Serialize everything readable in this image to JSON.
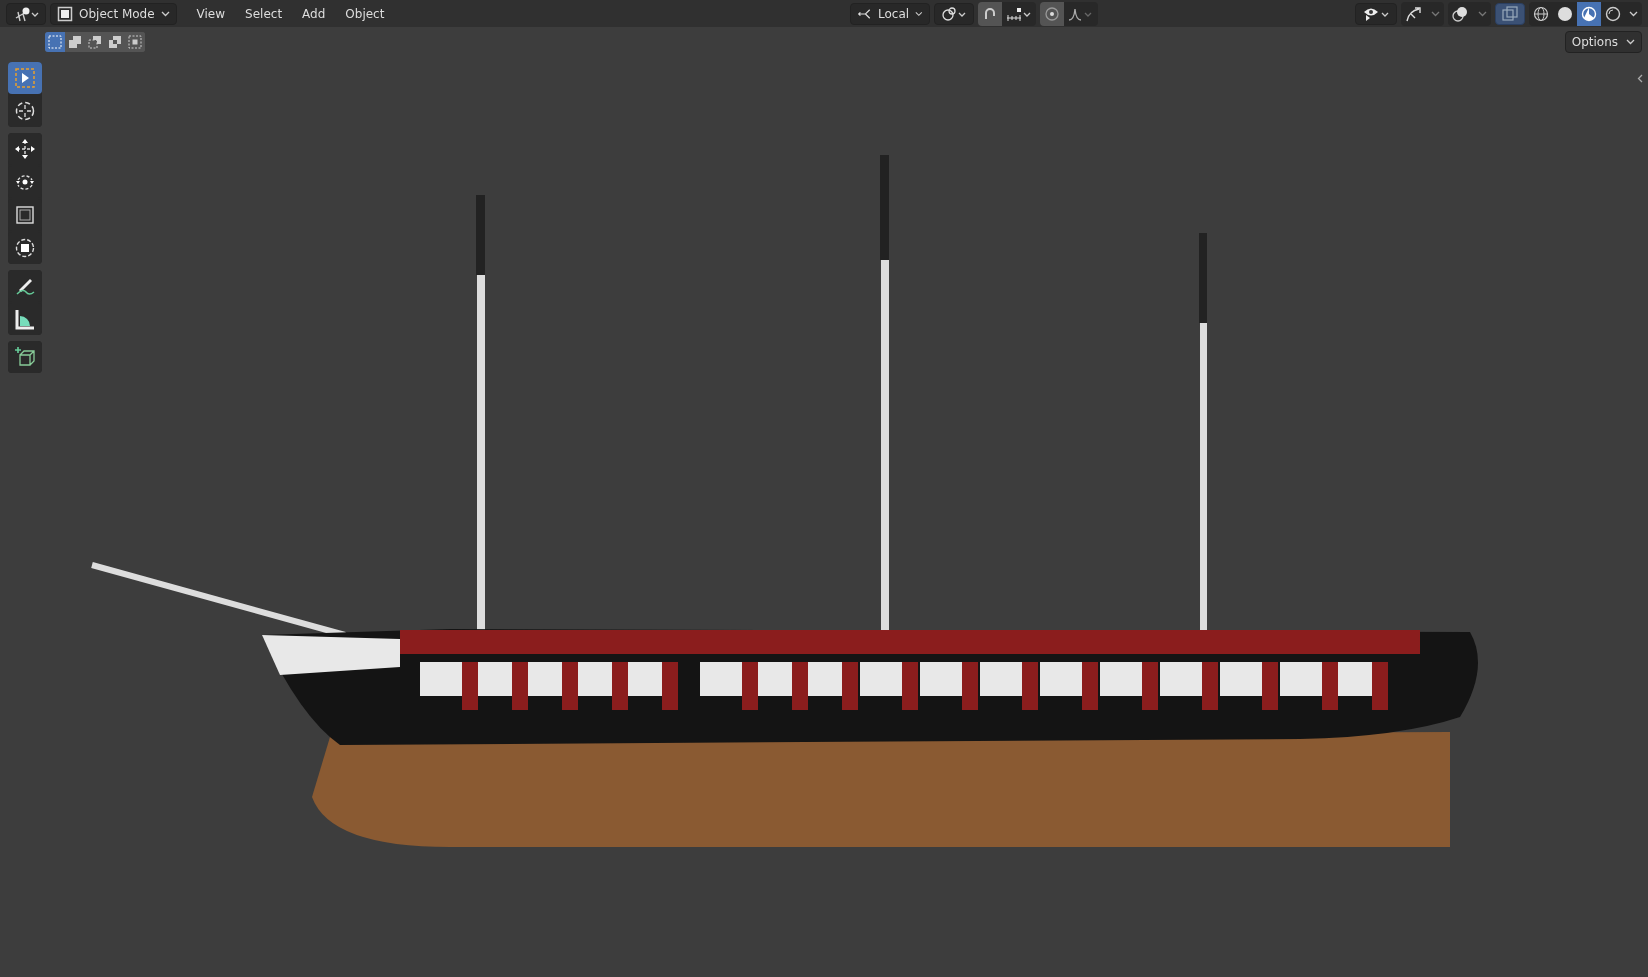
{
  "header": {
    "mode": "Object Mode",
    "menus": [
      "View",
      "Select",
      "Add",
      "Object"
    ],
    "orientation": "Local",
    "snap": {
      "on": true
    },
    "proportional": {
      "on": true
    },
    "xray": {
      "on": true
    },
    "shading": [
      {
        "kind": "wireframe",
        "selected": false
      },
      {
        "kind": "solid",
        "selected": false
      },
      {
        "kind": "material",
        "selected": true
      },
      {
        "kind": "rendered",
        "selected": false
      }
    ]
  },
  "select_modes": [
    {
      "kind": "new",
      "selected": true
    },
    {
      "kind": "extend",
      "selected": false
    },
    {
      "kind": "subtract",
      "selected": false
    },
    {
      "kind": "invert",
      "selected": false
    },
    {
      "kind": "intersect",
      "selected": false
    }
  ],
  "options": "Options",
  "toolbar": [
    {
      "tools": [
        {
          "kind": "select-box",
          "selected": true
        },
        {
          "kind": "cursor",
          "selected": false
        }
      ]
    },
    {
      "tools": [
        {
          "kind": "move",
          "selected": false
        },
        {
          "kind": "rotate",
          "selected": false
        },
        {
          "kind": "scale",
          "selected": false
        },
        {
          "kind": "transform",
          "selected": false
        }
      ]
    },
    {
      "tools": [
        {
          "kind": "annotate",
          "selected": false
        },
        {
          "kind": "measure",
          "selected": false
        }
      ]
    },
    {
      "tools": [
        {
          "kind": "add-cube",
          "selected": false
        }
      ]
    }
  ]
}
